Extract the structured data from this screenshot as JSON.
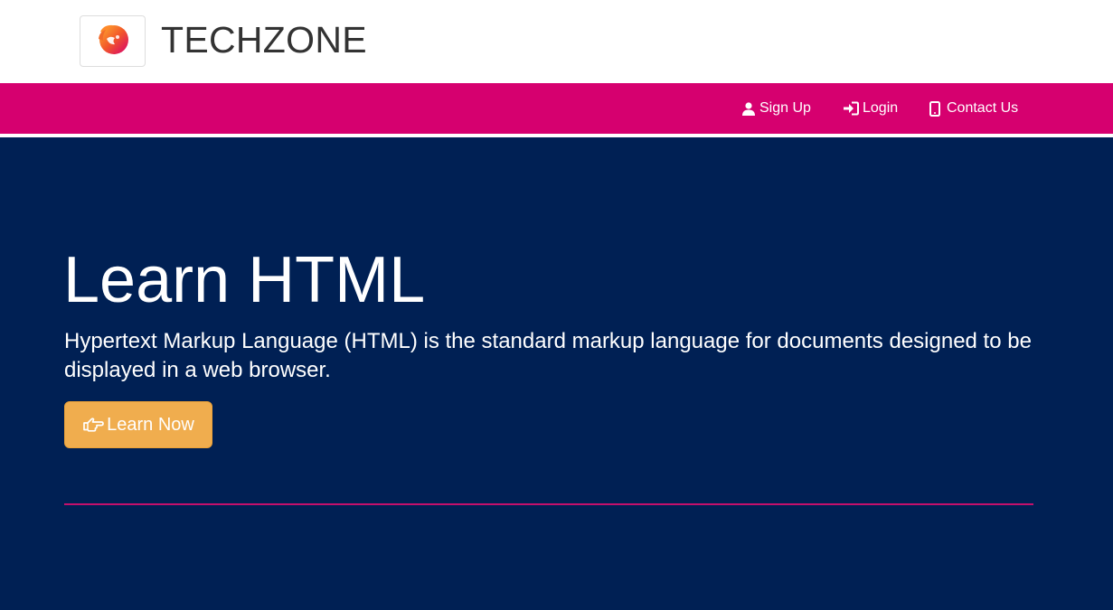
{
  "header": {
    "brand": "TECHZONE",
    "logo_icon": "lion-head-logo-icon"
  },
  "nav": {
    "items": [
      {
        "label": "Sign Up",
        "icon": "user-icon"
      },
      {
        "label": "Login",
        "icon": "login-icon"
      },
      {
        "label": "Contact Us",
        "icon": "mobile-phone-icon"
      }
    ]
  },
  "hero": {
    "title": "Learn HTML",
    "description": "Hypertext Markup Language (HTML) is the standard markup language for documents designed to be displayed in a web browser.",
    "button_label": "Learn Now",
    "button_icon": "hand-pointing-right-icon"
  },
  "colors": {
    "navbar": "#d6006f",
    "hero_background": "#002054",
    "button": "#f0ad4e",
    "divider": "#c4106c"
  }
}
